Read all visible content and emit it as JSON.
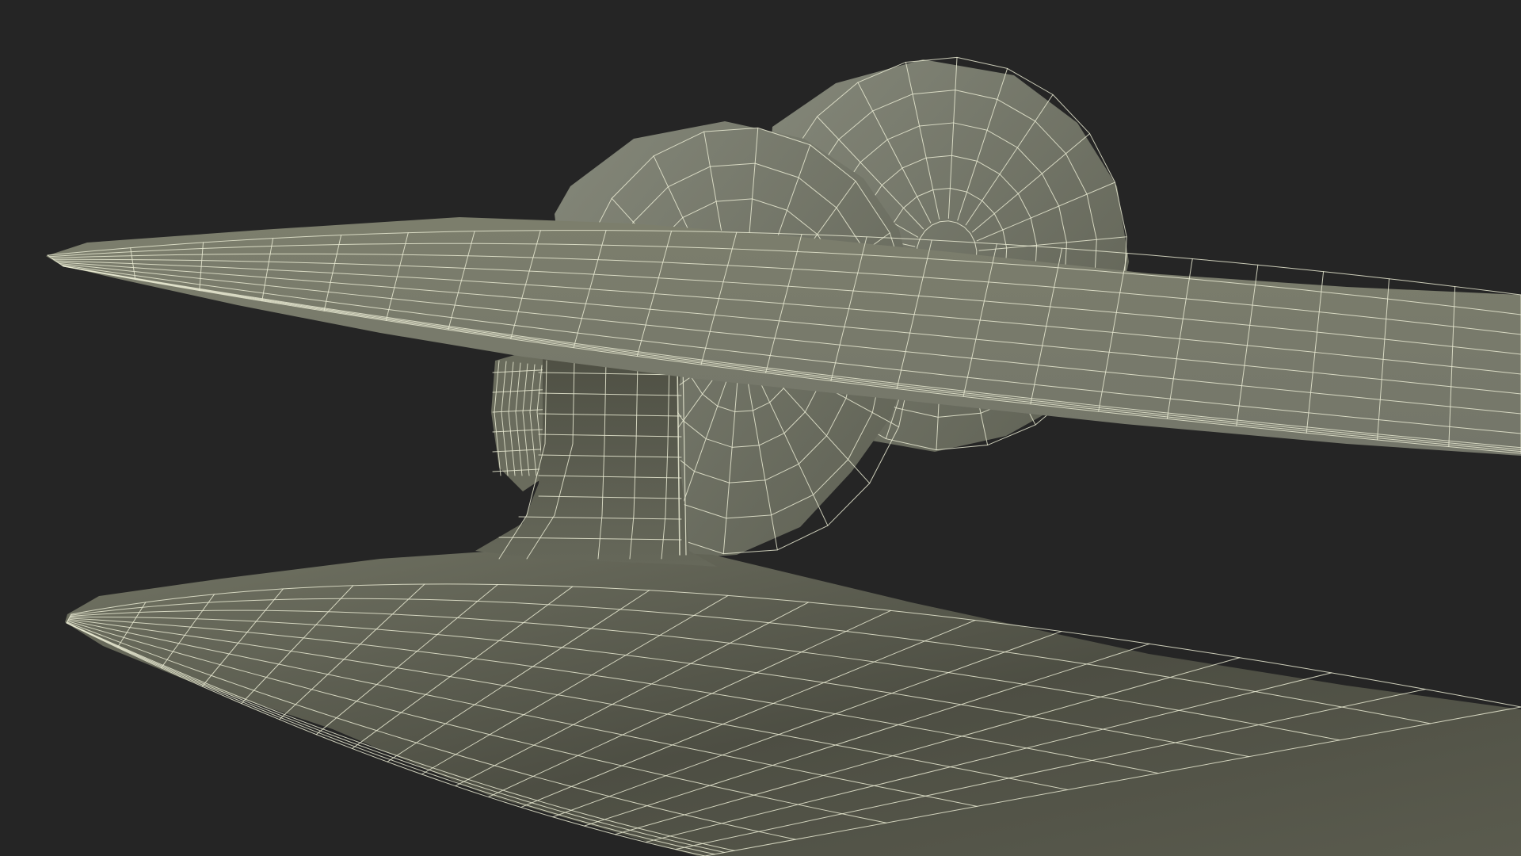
{
  "scene": {
    "description_visible_text": "",
    "background_color": "#252525",
    "mesh_fill_light": "#7b7d6b",
    "mesh_fill_mid": "#6a6c5c",
    "mesh_fill_dark": "#4d4e42",
    "wire_color": "#e9ead2",
    "objects": [
      {
        "name": "rear-flange-disc"
      },
      {
        "name": "front-flange-disc"
      },
      {
        "name": "central-hub"
      },
      {
        "name": "upper-curved-blade"
      },
      {
        "name": "connecting-neck"
      },
      {
        "name": "lower-curved-blade"
      }
    ]
  }
}
